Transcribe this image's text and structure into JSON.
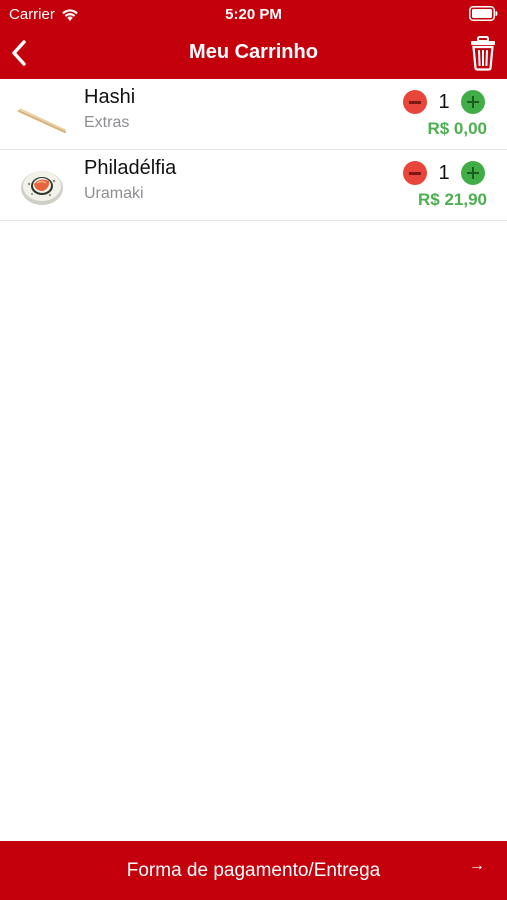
{
  "status_bar": {
    "carrier": "Carrier",
    "time": "5:20 PM",
    "icons": [
      "wifi-icon",
      "battery-icon"
    ]
  },
  "nav": {
    "title": "Meu Carrinho",
    "back_icon": "chevron-left-icon",
    "trash_icon": "trash-icon"
  },
  "cart": {
    "items": [
      {
        "name": "Hashi",
        "category": "Extras",
        "quantity": "1",
        "price": "R$ 0,00",
        "thumbnail": "chopsticks-image"
      },
      {
        "name": "Philadélfia",
        "category": "Uramaki",
        "quantity": "1",
        "price": "R$ 21,90",
        "thumbnail": "sushi-roll-image"
      }
    ]
  },
  "footer": {
    "label": "Forma de pagamento/Entrega",
    "arrow": "→"
  },
  "colors": {
    "brand_red": "#c3000b",
    "price_green": "#4caf50",
    "minus_red": "#e8463a",
    "plus_green": "#41ad46"
  }
}
